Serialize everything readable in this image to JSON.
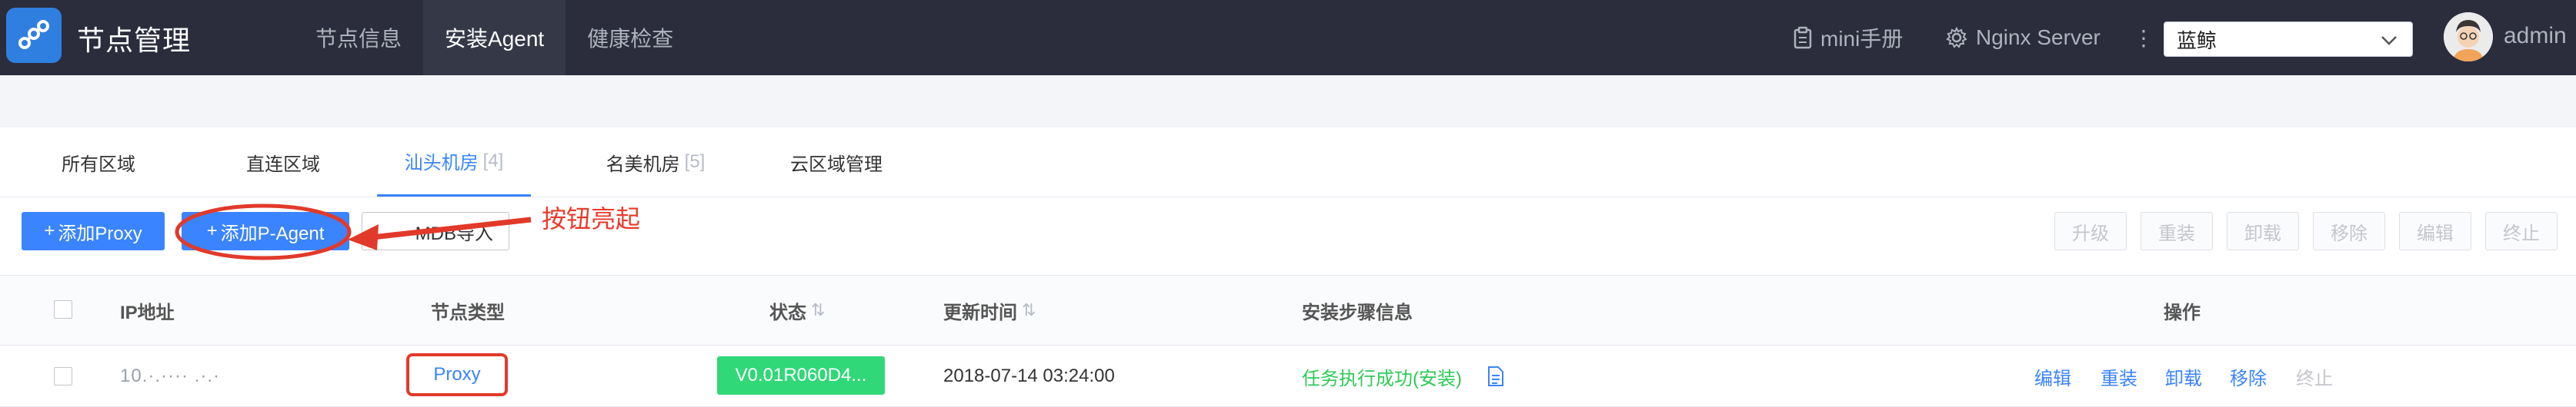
{
  "app": {
    "title": "节点管理"
  },
  "nav": {
    "items": [
      "节点信息",
      "安装Agent",
      "健康检查"
    ],
    "active_index": 1
  },
  "top_right": {
    "manual": "mini手册",
    "server": "Nginx Server",
    "business_select": "蓝鲸",
    "user": "admin"
  },
  "tabs": [
    {
      "label": "所有区域",
      "count": ""
    },
    {
      "label": "直连区域",
      "count": ""
    },
    {
      "label": "汕头机房",
      "count": "[4]"
    },
    {
      "label": "名美机房",
      "count": "[5]"
    },
    {
      "label": "云区域管理",
      "count": ""
    }
  ],
  "active_tab": 2,
  "toolbar": {
    "add_proxy": "添加Proxy",
    "add_pagent": "添加P-Agent",
    "cmdb_import": "从CMDB导入",
    "cmdb_import_visible": "MDB导入",
    "annotation": "按钮亮起",
    "batch": {
      "upgrade": "升级",
      "reinstall": "重装",
      "uninstall": "卸载",
      "remove": "移除",
      "edit": "编辑",
      "terminate": "终止"
    }
  },
  "table": {
    "columns": {
      "ip": "IP地址",
      "node_type": "节点类型",
      "status": "状态",
      "updated": "更新时间",
      "steps": "安装步骤信息",
      "actions": "操作"
    },
    "sort_icon": "⇅",
    "rows": [
      {
        "ip": "10.·.···· .·.·",
        "node_type": "Proxy",
        "status": "V0.01R060D4...",
        "updated": "2018-07-14 03:24:00",
        "steps": "任务执行成功(安装)",
        "actions": {
          "edit": "编辑",
          "reinstall": "重装",
          "uninstall": "卸载",
          "remove": "移除",
          "terminate": "终止"
        }
      }
    ]
  },
  "colors": {
    "topbar": "#2b2d3c",
    "accent": "#3a84ff",
    "annotation": "#ea3a2a",
    "status_ok": "#30d878",
    "success_text": "#2dcb56"
  }
}
